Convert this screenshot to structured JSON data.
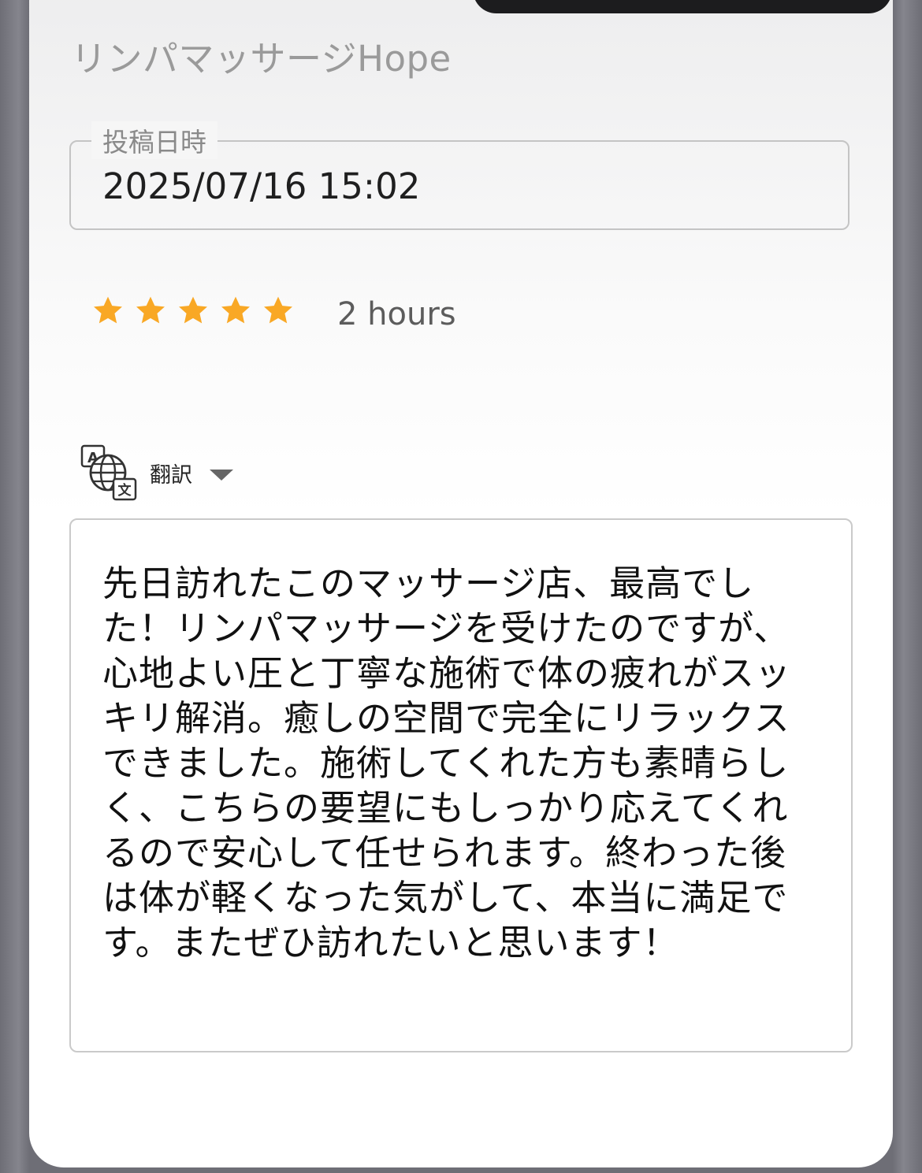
{
  "shop": {
    "name": "リンパマッサージHope"
  },
  "post_date": {
    "legend": "投稿日時",
    "value": "2025/07/16 15:02"
  },
  "rating": {
    "stars": 5,
    "max": 5,
    "color": "#f9a825",
    "time_ago": "2 hours"
  },
  "translate": {
    "label": "翻訳",
    "icon": "translate-icon"
  },
  "review": {
    "text": "先日訪れたこのマッサージ店、最高でした！リンパマッサージを受けたのですが、心地よい圧と丁寧な施術で体の疲れがスッキリ解消。癒しの空間で完全にリラックスできました。施術してくれた方も素晴らしく、こちらの要望にもしっかり応えてくれるので安心して任せられます。終わった後は体が軽くなった気がして、本当に満足です。またぜひ訪れたいと思います！"
  }
}
